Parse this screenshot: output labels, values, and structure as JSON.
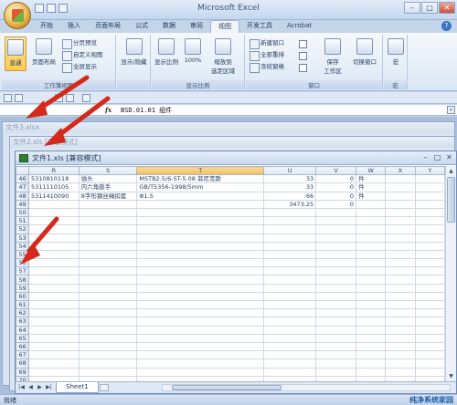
{
  "app": {
    "title": "Microsoft Excel"
  },
  "tabs": [
    {
      "label": "开始"
    },
    {
      "label": "插入"
    },
    {
      "label": "页面布局"
    },
    {
      "label": "公式"
    },
    {
      "label": "数据"
    },
    {
      "label": "审阅"
    },
    {
      "label": "视图"
    },
    {
      "label": "开发工具"
    },
    {
      "label": "Acrobat"
    }
  ],
  "active_tab": "视图",
  "ribbon": {
    "workbook_views": {
      "label": "工作簿视图",
      "normal": "普通",
      "page_layout": "页面布局",
      "page_break": "分页预览",
      "custom_view": "自定义视图",
      "full_screen": "全屏显示"
    },
    "show_hide": {
      "label": "显示/隐藏"
    },
    "zoom": {
      "label": "显示比例",
      "zoom": "显示比例",
      "hundred": "100%",
      "zoom_to_selection": "缩放到",
      "zoom_to_selection_2": "选定区域"
    },
    "window": {
      "label": "窗口",
      "new_window": "新建窗口",
      "arrange_all": "全部重排",
      "freeze_panes": "冻结窗格",
      "save_workspace": "保存",
      "save_workspace_2": "工作区",
      "switch_windows": "切换窗口"
    },
    "macros": {
      "label": "宏",
      "macros": "宏"
    }
  },
  "formula_bar": {
    "fx": "fx",
    "content": "BSD.01.01 组件"
  },
  "background_windows": [
    {
      "title": "文件3.xlsx"
    },
    {
      "title": "文件2.xls [兼容模式]"
    }
  ],
  "active_window": {
    "title": "文件1.xls [兼容模式]",
    "columns": [
      "R",
      "S",
      "T",
      "U",
      "V",
      "W",
      "X",
      "Y"
    ],
    "rows": [
      {
        "n": "46",
        "R": "5310810118",
        "S": "插头",
        "T": "MSTB2.5/6-ST-5.08 菲尼克斯",
        "U": "33",
        "V": "0",
        "W": "件"
      },
      {
        "n": "47",
        "R": "5311110105",
        "S": "内六角扳手",
        "T": "GB/T5356-1998/5mm",
        "U": "33",
        "V": "0",
        "W": "件"
      },
      {
        "n": "48",
        "R": "5311410090",
        "S": "8字形钢丝绳扣套",
        "T": "Φ1.5",
        "U": "66",
        "V": "0",
        "W": "件"
      },
      {
        "n": "49",
        "R": "",
        "S": "",
        "T": "",
        "U": "3473.25",
        "V": "0",
        "W": ""
      },
      {
        "n": "50"
      },
      {
        "n": "51"
      },
      {
        "n": "52"
      },
      {
        "n": "53"
      },
      {
        "n": "54"
      },
      {
        "n": "55"
      },
      {
        "n": "56"
      },
      {
        "n": "57"
      },
      {
        "n": "58"
      },
      {
        "n": "59"
      },
      {
        "n": "60"
      },
      {
        "n": "61"
      },
      {
        "n": "62"
      },
      {
        "n": "63"
      },
      {
        "n": "64"
      },
      {
        "n": "65"
      },
      {
        "n": "66"
      },
      {
        "n": "67"
      },
      {
        "n": "68"
      },
      {
        "n": "69"
      },
      {
        "n": "70"
      }
    ],
    "sheet_tab": "Sheet1"
  },
  "status": {
    "text": "就绪"
  },
  "watermark": {
    "text": "纯净系统家园"
  },
  "colors": {
    "arrow": "#d42a1c",
    "accent": "#ffc94d"
  }
}
